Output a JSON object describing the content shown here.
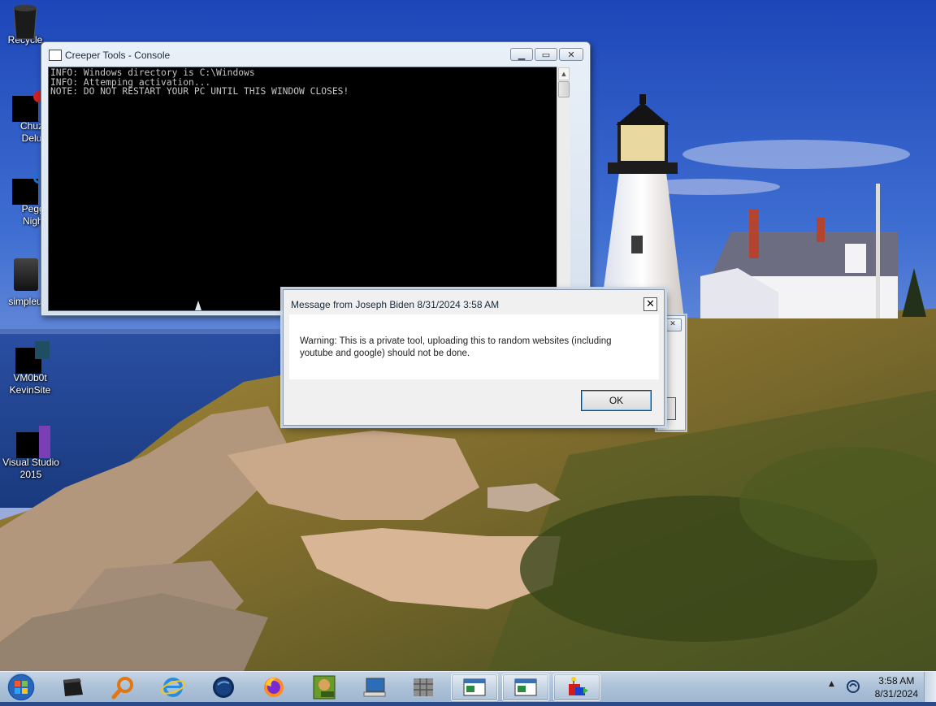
{
  "desktop": {
    "icons": [
      {
        "label": "Recycle",
        "icon": "recycle-bin-icon"
      },
      {
        "label": "Chuzz\nDelux",
        "icon": "chuzzle-icon"
      },
      {
        "label": "Peggl\nNigh.",
        "icon": "peggle-icon"
      },
      {
        "label": "simpleur",
        "icon": "app-icon"
      },
      {
        "label": "VM0b0t\nKevinSite",
        "icon": "vm-icon"
      },
      {
        "label": "Visual Studio\n2015",
        "icon": "visual-studio-icon"
      }
    ]
  },
  "console": {
    "title": "Creeper Tools - Console",
    "lines": [
      "INFO: Windows directory is C:\\Windows",
      "INFO: Attemping activation...",
      "NOTE: DO NOT RESTART YOUR PC UNTIL THIS WINDOW CLOSES!"
    ]
  },
  "message_box": {
    "title": "Message from Joseph Biden 8/31/2024 3:58 AM",
    "text": "Warning: This is a private tool, uploading this to random websites (including youtube and google) should not be done.",
    "ok_label": "OK",
    "close_label": "✕"
  },
  "taskbar": {
    "pinned": [
      "terminal-icon",
      "search-icon",
      "internet-explorer-icon",
      "globe-icon",
      "firefox-icon",
      "game-box-icon",
      "computer-icon",
      "app-grid-icon"
    ],
    "open_windows": [
      "console-window",
      "console-window-2",
      "tool-window"
    ],
    "clock_time": "3:58 AM",
    "clock_date": "8/31/2024",
    "colors": {
      "accent": "#aec3d9"
    }
  }
}
